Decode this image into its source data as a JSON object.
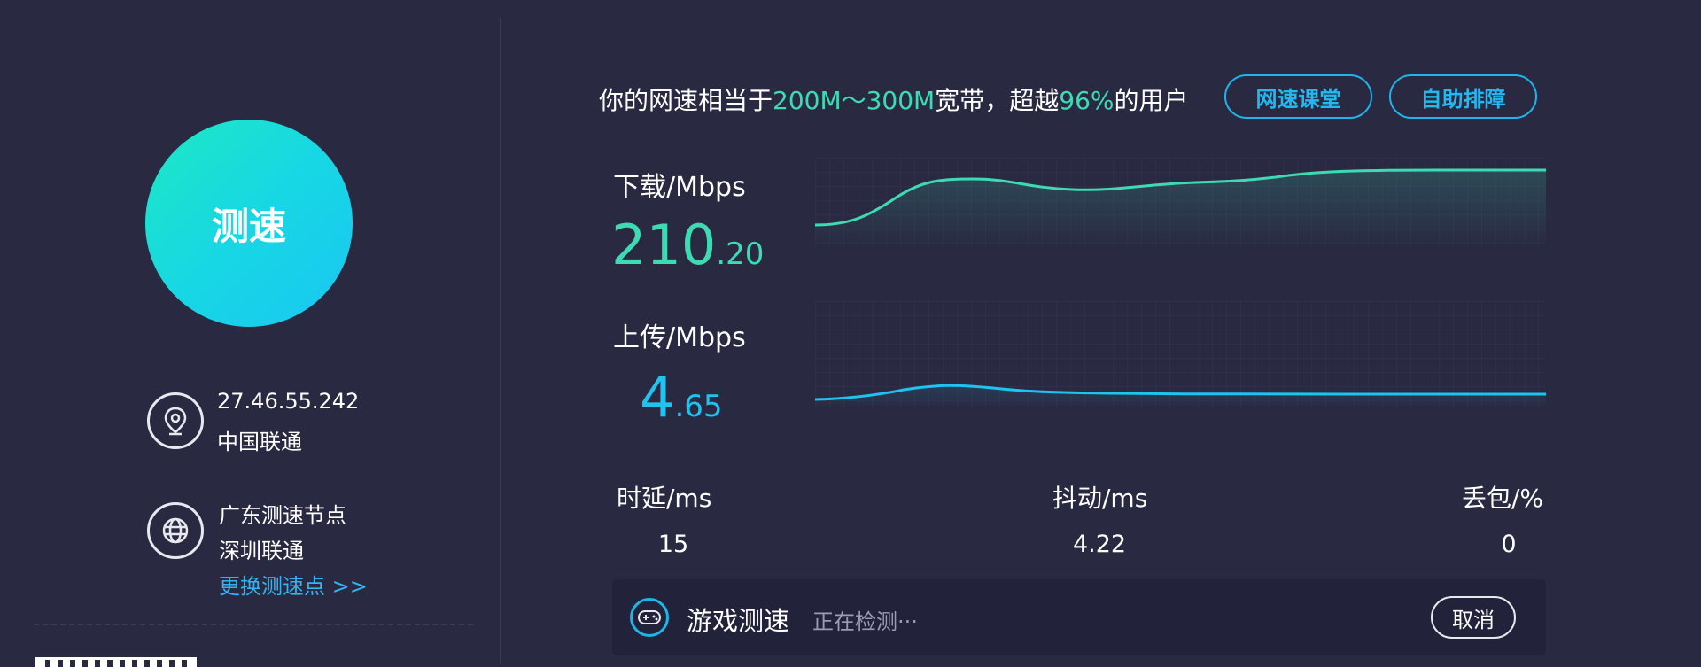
{
  "start_button": {
    "label": "测速"
  },
  "ip_info": {
    "ip": "27.46.55.242",
    "isp": "中国联通",
    "icon": "location-pin-icon"
  },
  "node_info": {
    "name": "广东测速节点",
    "location": "深圳联通",
    "change_link": "更换测速点 >>",
    "icon": "globe-icon"
  },
  "summary": {
    "prefix": "你的网速相当于",
    "bandwidth": "200M～300M",
    "middle": "宽带，超越",
    "percent": "96%",
    "suffix": "的用户"
  },
  "buttons": {
    "speed_class": "网速课堂",
    "self_troubleshoot": "自助排障"
  },
  "download": {
    "label": "下载/Mbps",
    "value_int": "210",
    "value_dec": ".20"
  },
  "upload": {
    "label": "上传/Mbps",
    "value_int": "4",
    "value_dec": ".65"
  },
  "stats": {
    "latency": {
      "label": "时延/ms",
      "value": "15"
    },
    "jitter": {
      "label": "抖动/ms",
      "value": "4.22"
    },
    "loss": {
      "label": "丢包/%",
      "value": "0"
    }
  },
  "game_test": {
    "title": "游戏测速",
    "status": "正在检测···",
    "cancel": "取消",
    "icon": "gamepad-icon"
  },
  "colors": {
    "background": "#292a42",
    "download_accent": "#3ddbb4",
    "upload_accent": "#1ec3f0",
    "link": "#2fb5f5"
  }
}
